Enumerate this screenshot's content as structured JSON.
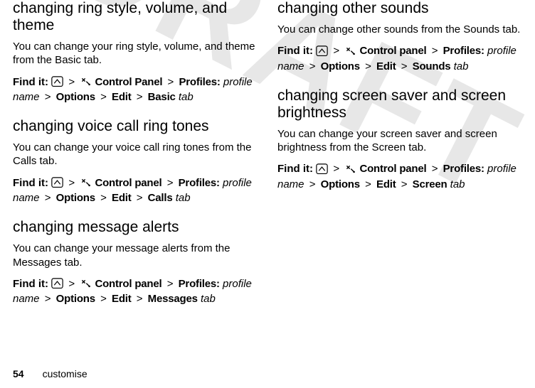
{
  "watermark": "DRAFT",
  "left": {
    "s1": {
      "title": "changing ring style, volume, and theme",
      "body": "You can change your ring style, volume, and theme from the Basic tab.",
      "find_lead": "Find it:",
      "cp": "Control Panel",
      "profiles": "Profiles:",
      "profile_name": "profile name",
      "options": "Options",
      "edit": "Edit",
      "last": "Basic",
      "tab": "tab"
    },
    "s2": {
      "title": "changing voice call ring tones",
      "body": "You can change your voice call ring tones from the Calls tab.",
      "find_lead": "Find it:",
      "cp": "Control panel",
      "profiles": "Profiles:",
      "profile_name": "profile name",
      "options": "Options",
      "edit": "Edit",
      "last": "Calls",
      "tab": "tab"
    },
    "s3": {
      "title": "changing message alerts",
      "body": "You can change your message alerts from the Messages tab.",
      "find_lead": "Find it:",
      "cp": "Control panel",
      "profiles": "Profiles:",
      "profile_name": "profile name",
      "options": "Options",
      "edit": "Edit",
      "last": "Messages",
      "tab": "tab"
    }
  },
  "right": {
    "s1": {
      "title": "changing other sounds",
      "body": "You can change other sounds from the Sounds tab.",
      "find_lead": "Find it:",
      "cp": "Control panel",
      "profiles": "Profiles:",
      "profile_name": "profile name",
      "options": "Options",
      "edit": "Edit",
      "last": "Sounds",
      "tab": "tab"
    },
    "s2": {
      "title": "changing screen saver and screen brightness",
      "body": "You can change your screen saver and screen brightness from the Screen tab.",
      "find_lead": "Find it:",
      "cp": "Control panel",
      "profiles": "Profiles:",
      "profile_name": "profile name",
      "options": "Options",
      "edit": "Edit",
      "last": "Screen",
      "tab": "tab"
    }
  },
  "footer": {
    "page": "54",
    "section": "customise"
  },
  "glyph": {
    "gt": ">"
  }
}
